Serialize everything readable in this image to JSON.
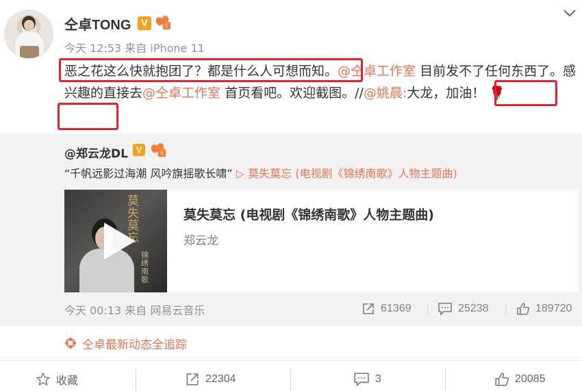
{
  "post": {
    "username": "仝卓TONG",
    "verified_badge": "V",
    "vip_badge": "5",
    "time": "今天 12:53",
    "source": "来自 iPhone 11",
    "text_segments": [
      {
        "text": "恶之花这么快就抱团了？都是什么人可想而知。",
        "type": "text"
      },
      {
        "text": "@仝卓工作室",
        "type": "link"
      },
      {
        "text": " 目前发不了任何东西了。感兴趣的直接去",
        "type": "text"
      },
      {
        "text": "@仝卓工作室",
        "type": "link"
      },
      {
        "text": " 首页看吧。欢迎截图。//",
        "type": "text"
      },
      {
        "text": "@姚晨",
        "type": "link"
      },
      {
        "text": ":",
        "type": "link"
      },
      {
        "text": "大龙，加油！",
        "type": "text"
      },
      {
        "text": "🌹",
        "type": "emoji"
      }
    ]
  },
  "repost": {
    "username": "@郑云龙DL",
    "verified_badge": "V",
    "vip_badge": "6",
    "text": "“千帆远影过海潮  风吟旗摇歌长啸”",
    "music_link": "▷ 莫失莫忘 (电视剧《锦绣南歌》人物主题曲)",
    "card": {
      "title": "莫失莫忘 (电视剧《锦绣南歌》人物主题曲)",
      "artist": "郑云龙",
      "cover_calligraphy": "莫失莫忘",
      "cover_small_text": "锦绣南歌"
    },
    "time": "今天 00:13",
    "source": "来自 网易云音乐",
    "reposts": "61369",
    "comments": "25238",
    "likes": "189720"
  },
  "topic": {
    "label": "仝卓最新动态全追踪",
    "icon": "flower-icon"
  },
  "actions": {
    "favorite": "收藏",
    "repost": "22304",
    "comment": "3",
    "like": "20085"
  },
  "colors": {
    "link": "#eb7350",
    "highlight": "#e8222b",
    "repost_bg": "#f2f2f2",
    "verified": "#f4a21b"
  }
}
